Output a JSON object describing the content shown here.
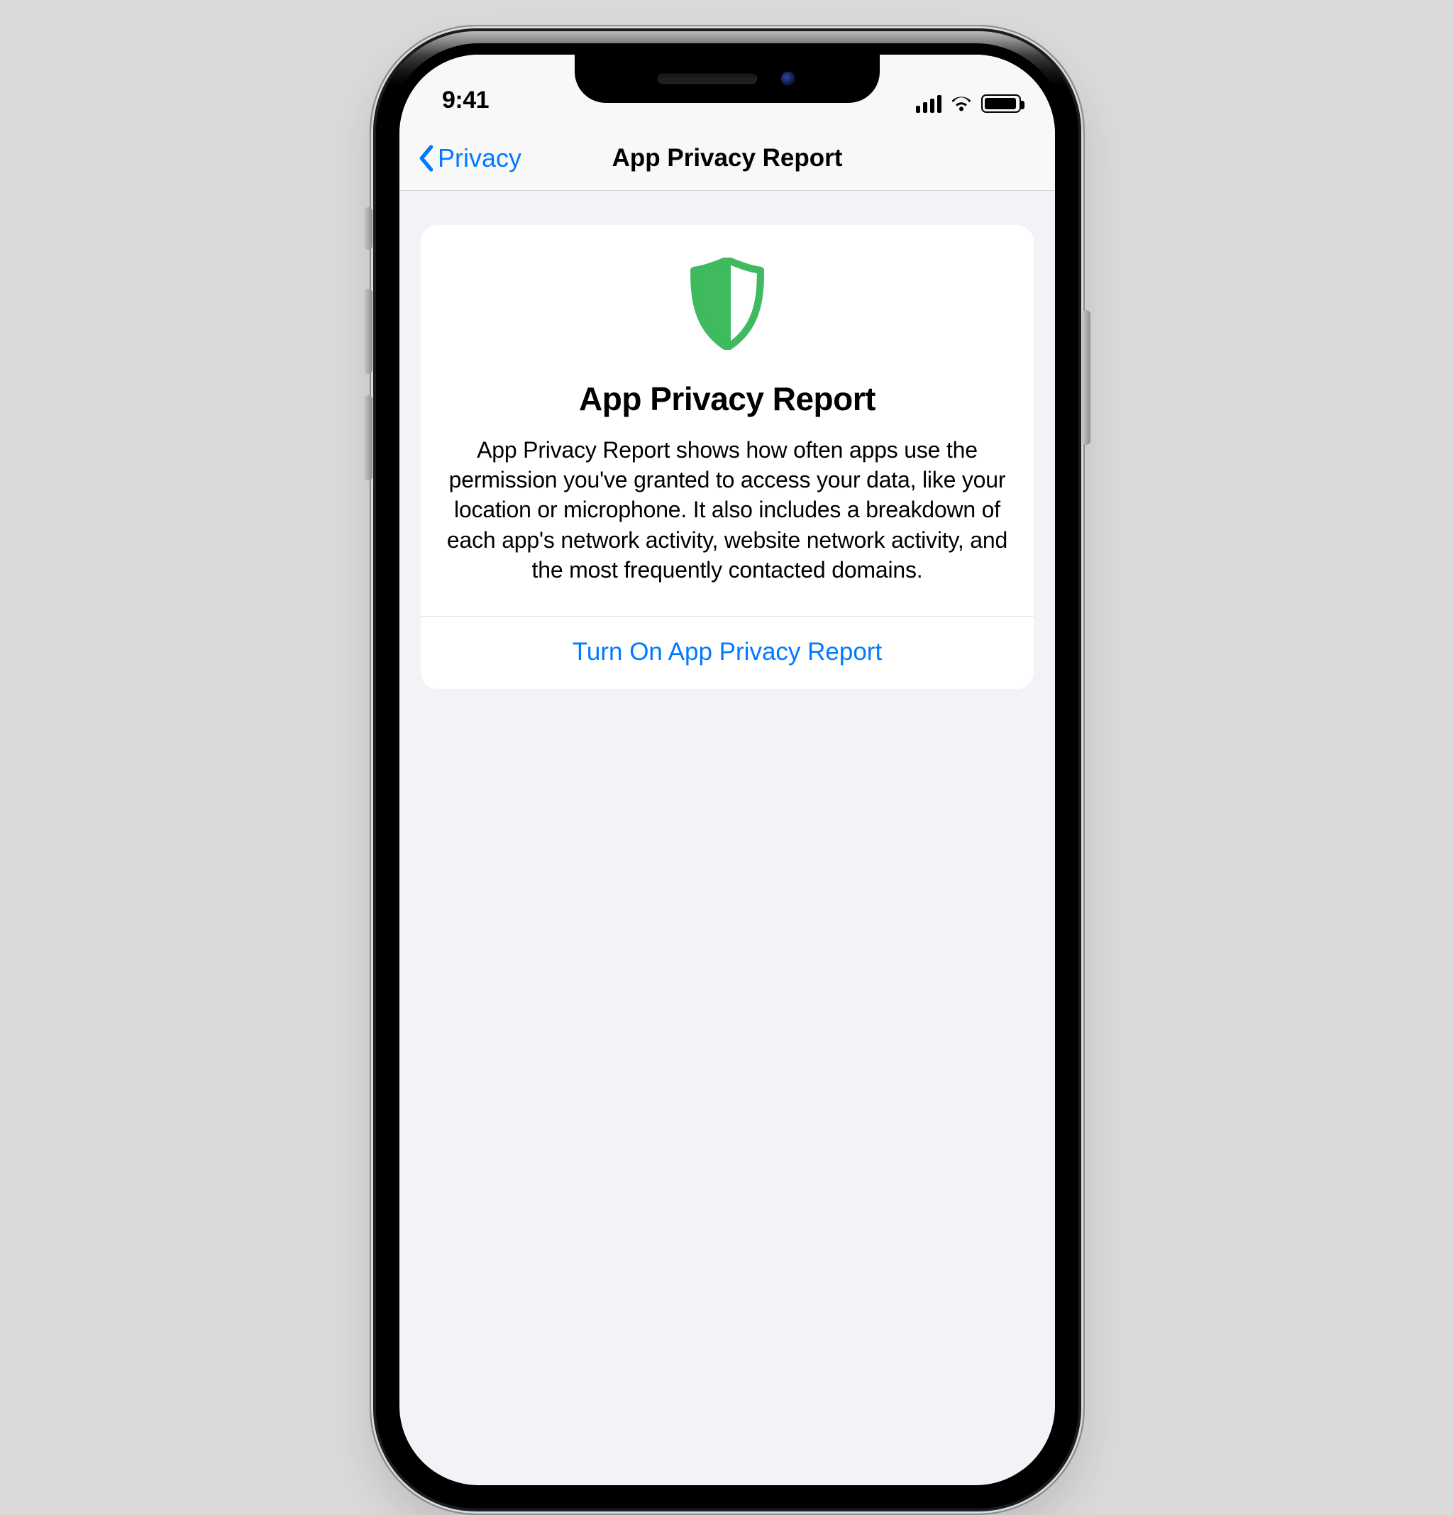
{
  "status": {
    "time": "9:41"
  },
  "nav": {
    "back_label": "Privacy",
    "title": "App Privacy Report"
  },
  "card": {
    "title": "App Privacy Report",
    "description": "App Privacy Report shows how often apps use the permission you've granted to access your data, like your location or microphone. It also includes a breakdown of each app's network activity, website network activity, and the most frequently contacted domains.",
    "turn_on_label": "Turn On App Privacy Report"
  },
  "colors": {
    "ios_blue": "#007aff",
    "shield_green": "#3fba5e"
  }
}
